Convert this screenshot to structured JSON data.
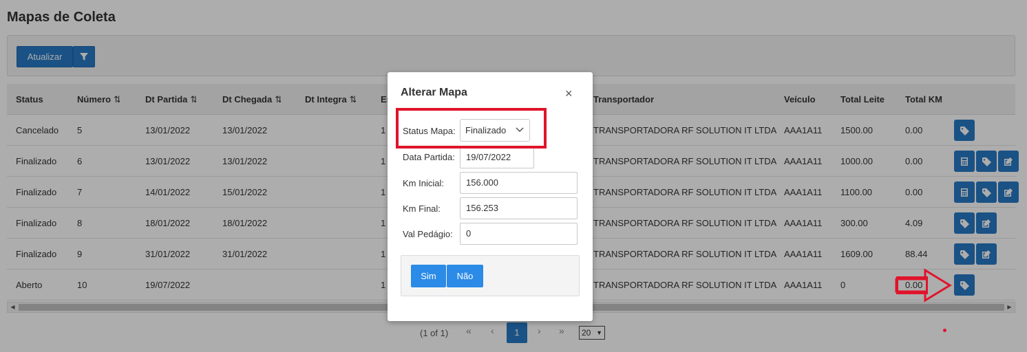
{
  "page": {
    "title": "Mapas de Coleta"
  },
  "toolbar": {
    "refresh_label": "Atualizar",
    "filter_icon": "filter-icon"
  },
  "table": {
    "columns": [
      {
        "key": "status",
        "label": "Status",
        "sortable": false
      },
      {
        "key": "numero",
        "label": "Número",
        "sortable": true
      },
      {
        "key": "dt_partida",
        "label": "Dt Partida",
        "sortable": true
      },
      {
        "key": "dt_chegada",
        "label": "Dt Chegada",
        "sortable": true
      },
      {
        "key": "dt_integra",
        "label": "Dt Integra",
        "sortable": true
      },
      {
        "key": "es",
        "label": "Es",
        "sortable": false
      },
      {
        "key": "transportador",
        "label": "Transportador",
        "sortable": false
      },
      {
        "key": "veiculo",
        "label": "Veículo",
        "sortable": false
      },
      {
        "key": "total_leite",
        "label": "Total Leite",
        "sortable": false
      },
      {
        "key": "total_km",
        "label": "Total KM",
        "sortable": false
      }
    ],
    "sort_icon": "⇅",
    "rows": [
      {
        "status": "Cancelado",
        "numero": "5",
        "dt_partida": "13/01/2022",
        "dt_chegada": "13/01/2022",
        "dt_integra": "",
        "es": "1",
        "transportador": "TRANSPORTADORA RF SOLUTION IT LTDA",
        "veiculo": "AAA1A11",
        "total_leite": "1500.00",
        "total_km": "0.00",
        "actions": [
          "tag"
        ]
      },
      {
        "status": "Finalizado",
        "numero": "6",
        "dt_partida": "13/01/2022",
        "dt_chegada": "13/01/2022",
        "dt_integra": "",
        "es": "1",
        "transportador": "TRANSPORTADORA RF SOLUTION IT LTDA",
        "veiculo": "AAA1A11",
        "total_leite": "1000.00",
        "total_km": "0.00",
        "actions": [
          "calc",
          "tag",
          "edit"
        ]
      },
      {
        "status": "Finalizado",
        "numero": "7",
        "dt_partida": "14/01/2022",
        "dt_chegada": "15/01/2022",
        "dt_integra": "",
        "es": "1",
        "transportador": "TRANSPORTADORA RF SOLUTION IT LTDA",
        "veiculo": "AAA1A11",
        "total_leite": "1100.00",
        "total_km": "0.00",
        "actions": [
          "calc",
          "tag",
          "edit"
        ]
      },
      {
        "status": "Finalizado",
        "numero": "8",
        "dt_partida": "18/01/2022",
        "dt_chegada": "18/01/2022",
        "dt_integra": "",
        "es": "1",
        "transportador": "TRANSPORTADORA RF SOLUTION IT LTDA",
        "veiculo": "AAA1A11",
        "total_leite": "300.00",
        "total_km": "4.09",
        "actions": [
          "tag",
          "edit"
        ]
      },
      {
        "status": "Finalizado",
        "numero": "9",
        "dt_partida": "31/01/2022",
        "dt_chegada": "31/01/2022",
        "dt_integra": "",
        "es": "1",
        "transportador": "TRANSPORTADORA RF SOLUTION IT LTDA",
        "veiculo": "AAA1A11",
        "total_leite": "1609.00",
        "total_km": "88.44",
        "actions": [
          "tag",
          "edit"
        ]
      },
      {
        "status": "Aberto",
        "numero": "10",
        "dt_partida": "19/07/2022",
        "dt_chegada": "",
        "dt_integra": "",
        "es": "1",
        "transportador": "TRANSPORTADORA RF SOLUTION IT LTDA",
        "veiculo": "AAA1A11",
        "total_leite": "0",
        "total_km": "0.00",
        "actions": [
          "tag"
        ]
      }
    ]
  },
  "paginator": {
    "summary": "(1 of 1)",
    "first": "«",
    "prev": "‹",
    "current": "1",
    "next": "›",
    "last": "»",
    "rows_per_page": "20"
  },
  "modal": {
    "title": "Alterar Mapa",
    "close": "×",
    "status_label": "Status Mapa:",
    "status_value": "Finalizado",
    "data_partida_label": "Data Partida:",
    "data_partida_value": "19/07/2022",
    "km_inicial_label": "Km Inicial:",
    "km_inicial_value": "156.000",
    "km_final_label": "Km Final:",
    "km_final_value": "156.253",
    "val_pedagio_label": "Val Pedágio:",
    "val_pedagio_value": "0",
    "yes_label": "Sim",
    "no_label": "Não"
  },
  "colors": {
    "primary": "#2779c4",
    "annotation": "#e0142b"
  }
}
